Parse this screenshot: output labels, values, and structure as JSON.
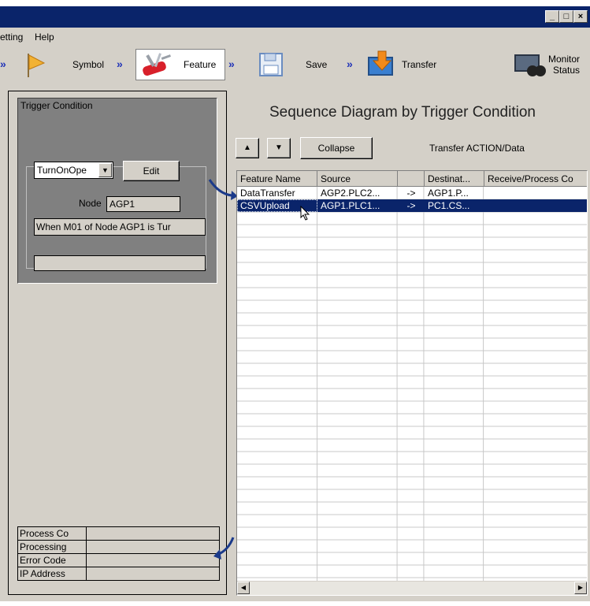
{
  "menu": {
    "setting": "etting",
    "help": "Help"
  },
  "toolbar": {
    "symbol": "Symbol",
    "feature": "Feature",
    "save": "Save",
    "transfer": "Transfer",
    "monitor_line1": "Monitor",
    "monitor_line2": "Status"
  },
  "trigger": {
    "title": "Trigger Condition",
    "combo_value": "TurnOnOpe",
    "edit_label": "Edit",
    "node_label": "Node",
    "node_value": "AGP1",
    "condition_text": "When M01  of Node AGP1  is Tur"
  },
  "status_rows": [
    {
      "label": "Process Co",
      "value": ""
    },
    {
      "label": "Processing",
      "value": ""
    },
    {
      "label": "Error Code",
      "value": ""
    },
    {
      "label": "IP Address",
      "value": ""
    }
  ],
  "sequence": {
    "title": "Sequence Diagram by Trigger Condition",
    "collapse_label": "Collapse",
    "action_label": "Transfer ACTION/Data",
    "columns": [
      "Feature Name",
      "Source",
      "",
      "Destinat...",
      "Receive/Process Co"
    ],
    "rows": [
      {
        "feature": "DataTransfer",
        "source": "AGP2.PLC2...",
        "arrow": "->",
        "dest": "AGP1.P...",
        "receive": "",
        "selected": false
      },
      {
        "feature": "CSVUpload",
        "source": "AGP1.PLC1...",
        "arrow": "->",
        "dest": "PC1.CS...",
        "receive": "",
        "selected": true
      }
    ]
  },
  "colors": {
    "title_bar": "#0a246a",
    "selection": "#0a246a",
    "chevron": "#2033b8",
    "connector": "#1b3a8a"
  }
}
